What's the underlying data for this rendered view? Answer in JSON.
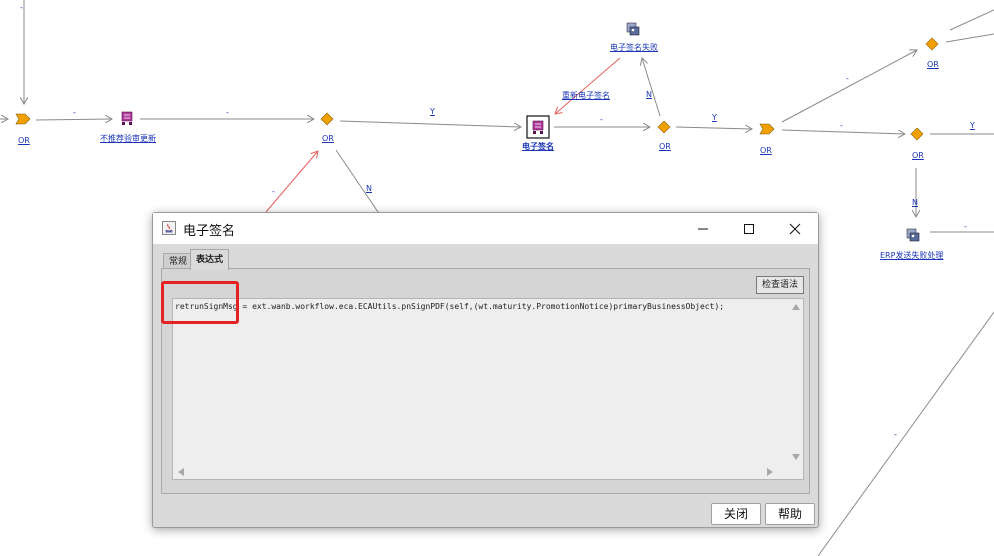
{
  "workflow": {
    "node_labels": {
      "not_recommend_update": "不推荐验审更新",
      "e_signature": "电子签名",
      "e_sign_failed": "电子签名失败",
      "resign": "重新电子签名",
      "erp_send_fail": "ERP发送失败处理"
    },
    "or_label": "OR",
    "edge_labels": {
      "dash": "-",
      "yes": "Y",
      "no": "N"
    },
    "colors": {
      "line": "#8a8a8a",
      "red_line": "#e86060",
      "diamond": "#f2a000",
      "link": "#1a35b8"
    }
  },
  "dialog": {
    "title": "电子签名",
    "tabs": [
      {
        "label": "常规"
      },
      {
        "label": "表达式"
      }
    ],
    "check_syntax_label": "检查语法",
    "expression": "retrunSignMsg = ext.wanb.workflow.eca.ECAUtils.pnSignPDF(self,(wt.maturity.PromotionNotice)primaryBusinessObject);",
    "buttons": {
      "close": "关闭",
      "help": "帮助"
    }
  }
}
